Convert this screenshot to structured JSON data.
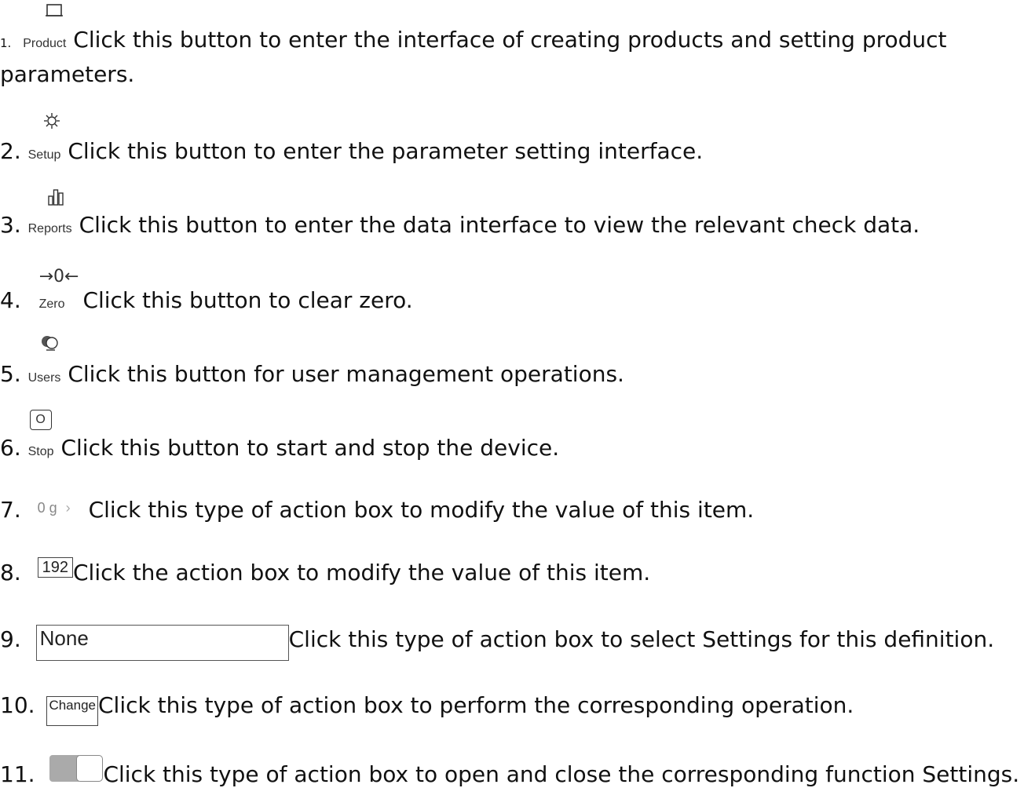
{
  "items": [
    {
      "num": "1.",
      "button": "Product",
      "text": "Click this button to enter the interface of creating products and setting product",
      "text2": "parameters.",
      "icon": "product-icon"
    },
    {
      "num": "2.",
      "button": "Setup",
      "text": "Click this button to enter the parameter setting interface.",
      "icon": "gear-icon"
    },
    {
      "num": "3.",
      "button": "Reports",
      "text": "Click this button to enter the data interface to view the relevant check data.",
      "icon": "bar-chart-icon"
    },
    {
      "num": "4.",
      "button": "Zero",
      "text": "Click this button to clear zero.",
      "icon": "zero-icon",
      "glyph": "→0←"
    },
    {
      "num": "5.",
      "button": "Users",
      "text": "Click this button for user management operations.",
      "icon": "users-icon"
    },
    {
      "num": "6.",
      "button": "Stop",
      "text": "Click this button to start and stop the device.",
      "icon": "power-icon",
      "glyph": "O"
    },
    {
      "num": "7.",
      "box": "0 g",
      "box_chevron": "›",
      "text": "Click this type of action box to modify the value of this item."
    },
    {
      "num": "8.",
      "box": "192",
      "text": "Click the action box to modify the value of this item."
    },
    {
      "num": "9.",
      "box": "None",
      "text": "Click this type of action box to select Settings for this definition."
    },
    {
      "num": "10.",
      "box": "Change",
      "text": "Click this type of action box to perform the corresponding operation."
    },
    {
      "num": "11.",
      "text": "Click this type of action box to open and close the corresponding function Settings.",
      "toggle_state": "off"
    }
  ]
}
